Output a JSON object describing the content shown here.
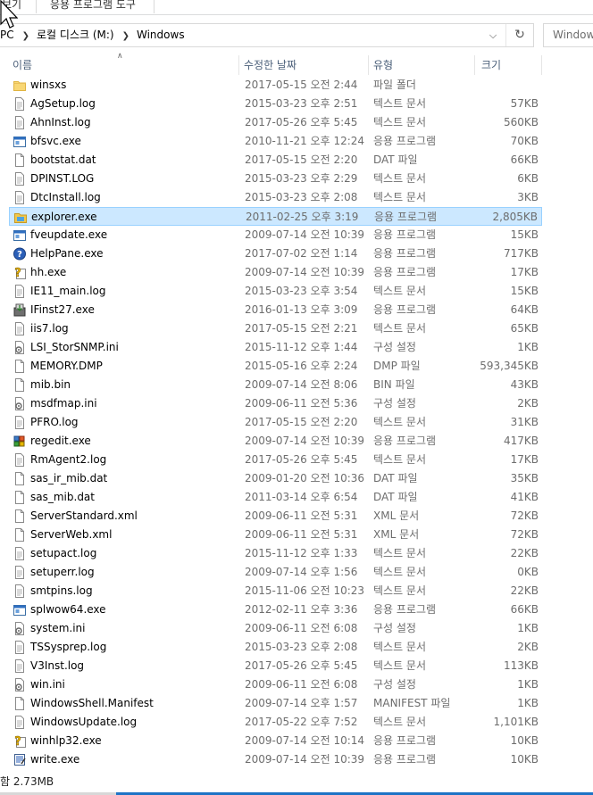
{
  "ribbon": {
    "tabs": [
      "보기",
      "응용 프로그램 도구"
    ]
  },
  "address": {
    "crumbs": [
      "PC",
      "로컬 디스크 (M:)",
      "Windows"
    ],
    "search_placeholder": "Windows"
  },
  "columns": {
    "name": "이름",
    "date": "수정한 날짜",
    "type": "유형",
    "size": "크기"
  },
  "files": [
    {
      "name": "winsxs",
      "date": "2017-05-15 오전 2:44",
      "type": "파일 폴더",
      "size": "",
      "icon": "folder-icon"
    },
    {
      "name": "AgSetup.log",
      "date": "2015-03-23 오후 2:51",
      "type": "텍스트 문서",
      "size": "57KB",
      "icon": "text-file-icon"
    },
    {
      "name": "AhnInst.log",
      "date": "2017-05-26 오후 5:45",
      "type": "텍스트 문서",
      "size": "560KB",
      "icon": "text-file-icon"
    },
    {
      "name": "bfsvc.exe",
      "date": "2010-11-21 오후 12:24",
      "type": "응용 프로그램",
      "size": "70KB",
      "icon": "app-window-icon"
    },
    {
      "name": "bootstat.dat",
      "date": "2017-05-15 오전 2:20",
      "type": "DAT 파일",
      "size": "66KB",
      "icon": "blank-file-icon"
    },
    {
      "name": "DPINST.LOG",
      "date": "2015-03-23 오후 2:29",
      "type": "텍스트 문서",
      "size": "6KB",
      "icon": "text-file-icon"
    },
    {
      "name": "DtcInstall.log",
      "date": "2015-03-23 오후 2:08",
      "type": "텍스트 문서",
      "size": "3KB",
      "icon": "text-file-icon"
    },
    {
      "name": "explorer.exe",
      "date": "2011-02-25 오후 3:19",
      "type": "응용 프로그램",
      "size": "2,805KB",
      "icon": "explorer-folder-icon",
      "selected": true
    },
    {
      "name": "fveupdate.exe",
      "date": "2009-07-14 오전 10:39",
      "type": "응용 프로그램",
      "size": "15KB",
      "icon": "app-window-icon"
    },
    {
      "name": "HelpPane.exe",
      "date": "2017-07-02 오전 1:14",
      "type": "응용 프로그램",
      "size": "717KB",
      "icon": "help-icon"
    },
    {
      "name": "hh.exe",
      "date": "2009-07-14 오전 10:39",
      "type": "응용 프로그램",
      "size": "17KB",
      "icon": "help-doc-icon"
    },
    {
      "name": "IE11_main.log",
      "date": "2015-03-23 오후 3:54",
      "type": "텍스트 문서",
      "size": "15KB",
      "icon": "text-file-icon"
    },
    {
      "name": "IFinst27.exe",
      "date": "2016-01-13 오후 3:09",
      "type": "응용 프로그램",
      "size": "64KB",
      "icon": "installer-icon"
    },
    {
      "name": "iis7.log",
      "date": "2017-05-15 오전 2:21",
      "type": "텍스트 문서",
      "size": "65KB",
      "icon": "text-file-icon"
    },
    {
      "name": "LSI_StorSNMP.ini",
      "date": "2015-11-12 오후 1:44",
      "type": "구성 설정",
      "size": "1KB",
      "icon": "settings-file-icon"
    },
    {
      "name": "MEMORY.DMP",
      "date": "2015-05-16 오후 2:24",
      "type": "DMP 파일",
      "size": "593,345KB",
      "icon": "blank-file-icon"
    },
    {
      "name": "mib.bin",
      "date": "2009-07-14 오전 8:06",
      "type": "BIN 파일",
      "size": "43KB",
      "icon": "blank-file-icon"
    },
    {
      "name": "msdfmap.ini",
      "date": "2009-06-11 오전 5:36",
      "type": "구성 설정",
      "size": "2KB",
      "icon": "settings-file-icon"
    },
    {
      "name": "PFRO.log",
      "date": "2017-05-15 오전 2:20",
      "type": "텍스트 문서",
      "size": "31KB",
      "icon": "text-file-icon"
    },
    {
      "name": "regedit.exe",
      "date": "2009-07-14 오전 10:39",
      "type": "응용 프로그램",
      "size": "417KB",
      "icon": "registry-icon"
    },
    {
      "name": "RmAgent2.log",
      "date": "2017-05-26 오후 5:45",
      "type": "텍스트 문서",
      "size": "17KB",
      "icon": "text-file-icon"
    },
    {
      "name": "sas_ir_mib.dat",
      "date": "2009-01-20 오전 10:36",
      "type": "DAT 파일",
      "size": "35KB",
      "icon": "blank-file-icon"
    },
    {
      "name": "sas_mib.dat",
      "date": "2011-03-14 오후 6:54",
      "type": "DAT 파일",
      "size": "41KB",
      "icon": "blank-file-icon"
    },
    {
      "name": "ServerStandard.xml",
      "date": "2009-06-11 오전 5:31",
      "type": "XML 문서",
      "size": "72KB",
      "icon": "blank-file-icon"
    },
    {
      "name": "ServerWeb.xml",
      "date": "2009-06-11 오전 5:31",
      "type": "XML 문서",
      "size": "72KB",
      "icon": "blank-file-icon"
    },
    {
      "name": "setupact.log",
      "date": "2015-11-12 오후 1:33",
      "type": "텍스트 문서",
      "size": "22KB",
      "icon": "text-file-icon"
    },
    {
      "name": "setuperr.log",
      "date": "2009-07-14 오후 1:56",
      "type": "텍스트 문서",
      "size": "0KB",
      "icon": "text-file-icon"
    },
    {
      "name": "smtpins.log",
      "date": "2015-11-06 오전 10:23",
      "type": "텍스트 문서",
      "size": "22KB",
      "icon": "text-file-icon"
    },
    {
      "name": "splwow64.exe",
      "date": "2012-02-11 오후 3:36",
      "type": "응용 프로그램",
      "size": "66KB",
      "icon": "app-window-icon"
    },
    {
      "name": "system.ini",
      "date": "2009-06-11 오전 6:08",
      "type": "구성 설정",
      "size": "1KB",
      "icon": "settings-file-icon"
    },
    {
      "name": "TSSysprep.log",
      "date": "2015-03-23 오후 2:08",
      "type": "텍스트 문서",
      "size": "2KB",
      "icon": "text-file-icon"
    },
    {
      "name": "V3Inst.log",
      "date": "2017-05-26 오후 5:45",
      "type": "텍스트 문서",
      "size": "113KB",
      "icon": "text-file-icon"
    },
    {
      "name": "win.ini",
      "date": "2009-06-11 오전 6:08",
      "type": "구성 설정",
      "size": "1KB",
      "icon": "settings-file-icon"
    },
    {
      "name": "WindowsShell.Manifest",
      "date": "2009-07-14 오후 1:57",
      "type": "MANIFEST 파일",
      "size": "1KB",
      "icon": "blank-file-icon"
    },
    {
      "name": "WindowsUpdate.log",
      "date": "2017-05-22 오후 7:52",
      "type": "텍스트 문서",
      "size": "1,101KB",
      "icon": "text-file-icon"
    },
    {
      "name": "winhlp32.exe",
      "date": "2009-07-14 오전 10:14",
      "type": "응용 프로그램",
      "size": "10KB",
      "icon": "help-doc-icon"
    },
    {
      "name": "write.exe",
      "date": "2009-07-14 오전 10:39",
      "type": "응용 프로그램",
      "size": "10KB",
      "icon": "wordpad-icon"
    }
  ],
  "status": {
    "text": "함 2.73MB"
  },
  "colors": {
    "selection_bg": "#cce8ff",
    "selection_border": "#99d1ff",
    "header_text": "#4c607a",
    "meta_text": "#6d6d6d",
    "taskbar_accent": "#1e74c6"
  }
}
